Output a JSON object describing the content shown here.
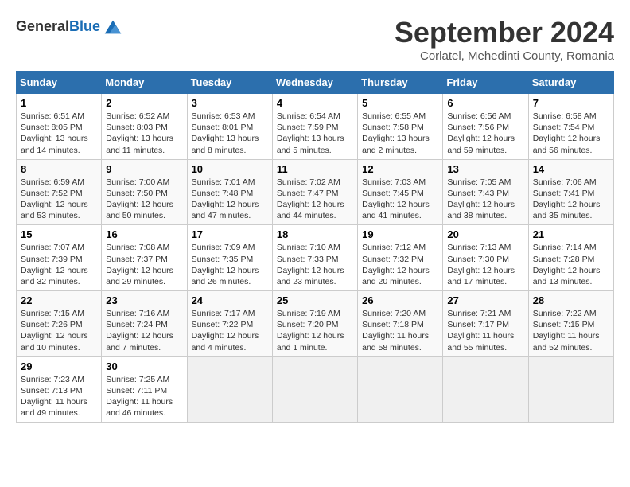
{
  "header": {
    "logo_line1": "General",
    "logo_line2": "Blue",
    "month_title": "September 2024",
    "location": "Corlatel, Mehedinti County, Romania"
  },
  "columns": [
    "Sunday",
    "Monday",
    "Tuesday",
    "Wednesday",
    "Thursday",
    "Friday",
    "Saturday"
  ],
  "weeks": [
    [
      {
        "day": "1",
        "sunrise": "Sunrise: 6:51 AM",
        "sunset": "Sunset: 8:05 PM",
        "daylight": "Daylight: 13 hours and 14 minutes."
      },
      {
        "day": "2",
        "sunrise": "Sunrise: 6:52 AM",
        "sunset": "Sunset: 8:03 PM",
        "daylight": "Daylight: 13 hours and 11 minutes."
      },
      {
        "day": "3",
        "sunrise": "Sunrise: 6:53 AM",
        "sunset": "Sunset: 8:01 PM",
        "daylight": "Daylight: 13 hours and 8 minutes."
      },
      {
        "day": "4",
        "sunrise": "Sunrise: 6:54 AM",
        "sunset": "Sunset: 7:59 PM",
        "daylight": "Daylight: 13 hours and 5 minutes."
      },
      {
        "day": "5",
        "sunrise": "Sunrise: 6:55 AM",
        "sunset": "Sunset: 7:58 PM",
        "daylight": "Daylight: 13 hours and 2 minutes."
      },
      {
        "day": "6",
        "sunrise": "Sunrise: 6:56 AM",
        "sunset": "Sunset: 7:56 PM",
        "daylight": "Daylight: 12 hours and 59 minutes."
      },
      {
        "day": "7",
        "sunrise": "Sunrise: 6:58 AM",
        "sunset": "Sunset: 7:54 PM",
        "daylight": "Daylight: 12 hours and 56 minutes."
      }
    ],
    [
      {
        "day": "8",
        "sunrise": "Sunrise: 6:59 AM",
        "sunset": "Sunset: 7:52 PM",
        "daylight": "Daylight: 12 hours and 53 minutes."
      },
      {
        "day": "9",
        "sunrise": "Sunrise: 7:00 AM",
        "sunset": "Sunset: 7:50 PM",
        "daylight": "Daylight: 12 hours and 50 minutes."
      },
      {
        "day": "10",
        "sunrise": "Sunrise: 7:01 AM",
        "sunset": "Sunset: 7:48 PM",
        "daylight": "Daylight: 12 hours and 47 minutes."
      },
      {
        "day": "11",
        "sunrise": "Sunrise: 7:02 AM",
        "sunset": "Sunset: 7:47 PM",
        "daylight": "Daylight: 12 hours and 44 minutes."
      },
      {
        "day": "12",
        "sunrise": "Sunrise: 7:03 AM",
        "sunset": "Sunset: 7:45 PM",
        "daylight": "Daylight: 12 hours and 41 minutes."
      },
      {
        "day": "13",
        "sunrise": "Sunrise: 7:05 AM",
        "sunset": "Sunset: 7:43 PM",
        "daylight": "Daylight: 12 hours and 38 minutes."
      },
      {
        "day": "14",
        "sunrise": "Sunrise: 7:06 AM",
        "sunset": "Sunset: 7:41 PM",
        "daylight": "Daylight: 12 hours and 35 minutes."
      }
    ],
    [
      {
        "day": "15",
        "sunrise": "Sunrise: 7:07 AM",
        "sunset": "Sunset: 7:39 PM",
        "daylight": "Daylight: 12 hours and 32 minutes."
      },
      {
        "day": "16",
        "sunrise": "Sunrise: 7:08 AM",
        "sunset": "Sunset: 7:37 PM",
        "daylight": "Daylight: 12 hours and 29 minutes."
      },
      {
        "day": "17",
        "sunrise": "Sunrise: 7:09 AM",
        "sunset": "Sunset: 7:35 PM",
        "daylight": "Daylight: 12 hours and 26 minutes."
      },
      {
        "day": "18",
        "sunrise": "Sunrise: 7:10 AM",
        "sunset": "Sunset: 7:33 PM",
        "daylight": "Daylight: 12 hours and 23 minutes."
      },
      {
        "day": "19",
        "sunrise": "Sunrise: 7:12 AM",
        "sunset": "Sunset: 7:32 PM",
        "daylight": "Daylight: 12 hours and 20 minutes."
      },
      {
        "day": "20",
        "sunrise": "Sunrise: 7:13 AM",
        "sunset": "Sunset: 7:30 PM",
        "daylight": "Daylight: 12 hours and 17 minutes."
      },
      {
        "day": "21",
        "sunrise": "Sunrise: 7:14 AM",
        "sunset": "Sunset: 7:28 PM",
        "daylight": "Daylight: 12 hours and 13 minutes."
      }
    ],
    [
      {
        "day": "22",
        "sunrise": "Sunrise: 7:15 AM",
        "sunset": "Sunset: 7:26 PM",
        "daylight": "Daylight: 12 hours and 10 minutes."
      },
      {
        "day": "23",
        "sunrise": "Sunrise: 7:16 AM",
        "sunset": "Sunset: 7:24 PM",
        "daylight": "Daylight: 12 hours and 7 minutes."
      },
      {
        "day": "24",
        "sunrise": "Sunrise: 7:17 AM",
        "sunset": "Sunset: 7:22 PM",
        "daylight": "Daylight: 12 hours and 4 minutes."
      },
      {
        "day": "25",
        "sunrise": "Sunrise: 7:19 AM",
        "sunset": "Sunset: 7:20 PM",
        "daylight": "Daylight: 12 hours and 1 minute."
      },
      {
        "day": "26",
        "sunrise": "Sunrise: 7:20 AM",
        "sunset": "Sunset: 7:18 PM",
        "daylight": "Daylight: 11 hours and 58 minutes."
      },
      {
        "day": "27",
        "sunrise": "Sunrise: 7:21 AM",
        "sunset": "Sunset: 7:17 PM",
        "daylight": "Daylight: 11 hours and 55 minutes."
      },
      {
        "day": "28",
        "sunrise": "Sunrise: 7:22 AM",
        "sunset": "Sunset: 7:15 PM",
        "daylight": "Daylight: 11 hours and 52 minutes."
      }
    ],
    [
      {
        "day": "29",
        "sunrise": "Sunrise: 7:23 AM",
        "sunset": "Sunset: 7:13 PM",
        "daylight": "Daylight: 11 hours and 49 minutes."
      },
      {
        "day": "30",
        "sunrise": "Sunrise: 7:25 AM",
        "sunset": "Sunset: 7:11 PM",
        "daylight": "Daylight: 11 hours and 46 minutes."
      },
      {
        "day": "",
        "sunrise": "",
        "sunset": "",
        "daylight": ""
      },
      {
        "day": "",
        "sunrise": "",
        "sunset": "",
        "daylight": ""
      },
      {
        "day": "",
        "sunrise": "",
        "sunset": "",
        "daylight": ""
      },
      {
        "day": "",
        "sunrise": "",
        "sunset": "",
        "daylight": ""
      },
      {
        "day": "",
        "sunrise": "",
        "sunset": "",
        "daylight": ""
      }
    ]
  ]
}
